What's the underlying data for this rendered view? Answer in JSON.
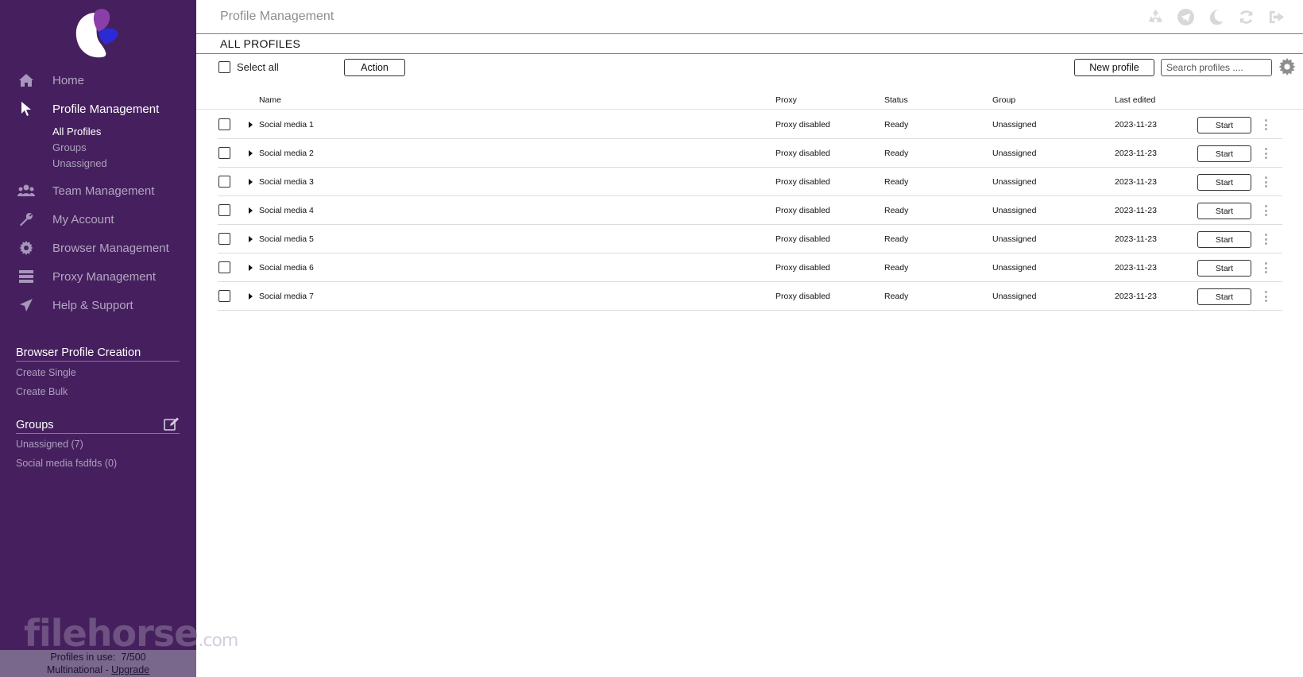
{
  "header": {
    "title": "Profile Management",
    "subtitle": "ALL PROFILES",
    "icons": [
      "recycle-icon",
      "telegram-icon",
      "moon-icon",
      "refresh-icon",
      "logout-icon"
    ]
  },
  "sidebar": {
    "nav": [
      {
        "label": "Home",
        "icon": "home-icon"
      },
      {
        "label": "Profile Management",
        "icon": "cursor-icon",
        "active": true
      },
      {
        "label": "Team Management",
        "icon": "users-icon"
      },
      {
        "label": "My Account",
        "icon": "wrench-icon"
      },
      {
        "label": "Browser Management",
        "icon": "gear-icon"
      },
      {
        "label": "Proxy Management",
        "icon": "server-icon"
      },
      {
        "label": "Help & Support",
        "icon": "send-icon"
      }
    ],
    "subnav": [
      "All Profiles",
      "Groups",
      "Unassigned"
    ],
    "creation": {
      "title": "Browser Profile Creation",
      "links": [
        "Create Single",
        "Create Bulk"
      ]
    },
    "groups": {
      "title": "Groups",
      "links": [
        "Unassigned (7)",
        "Social media fsdfds (0)"
      ]
    },
    "footer": {
      "profiles_label": "Profiles in use:",
      "profiles_value": "7/500",
      "plan": "Multinational -",
      "upgrade": "Upgrade"
    },
    "watermark": "filehorse",
    "watermark_suffix": ".com"
  },
  "toolbar": {
    "select_all": "Select all",
    "action": "Action",
    "new_profile": "New profile",
    "search_placeholder": "Search profiles ...."
  },
  "table": {
    "columns": [
      "Name",
      "Proxy",
      "Status",
      "Group",
      "Last edited"
    ],
    "start_label": "Start",
    "rows": [
      {
        "name": "Social media 1",
        "proxy": "Proxy disabled",
        "status": "Ready",
        "group": "Unassigned",
        "edited": "2023-11-23"
      },
      {
        "name": "Social media 2",
        "proxy": "Proxy disabled",
        "status": "Ready",
        "group": "Unassigned",
        "edited": "2023-11-23"
      },
      {
        "name": "Social media 3",
        "proxy": "Proxy disabled",
        "status": "Ready",
        "group": "Unassigned",
        "edited": "2023-11-23"
      },
      {
        "name": "Social media 4",
        "proxy": "Proxy disabled",
        "status": "Ready",
        "group": "Unassigned",
        "edited": "2023-11-23"
      },
      {
        "name": "Social media 5",
        "proxy": "Proxy disabled",
        "status": "Ready",
        "group": "Unassigned",
        "edited": "2023-11-23"
      },
      {
        "name": "Social media 6",
        "proxy": "Proxy disabled",
        "status": "Ready",
        "group": "Unassigned",
        "edited": "2023-11-23"
      },
      {
        "name": "Social media 7",
        "proxy": "Proxy disabled",
        "status": "Ready",
        "group": "Unassigned",
        "edited": "2023-11-23"
      }
    ]
  },
  "colors": {
    "sidebar_bg": "#46205e",
    "logo_purple": "#8a3fa8",
    "logo_blue": "#2a2bd6"
  }
}
